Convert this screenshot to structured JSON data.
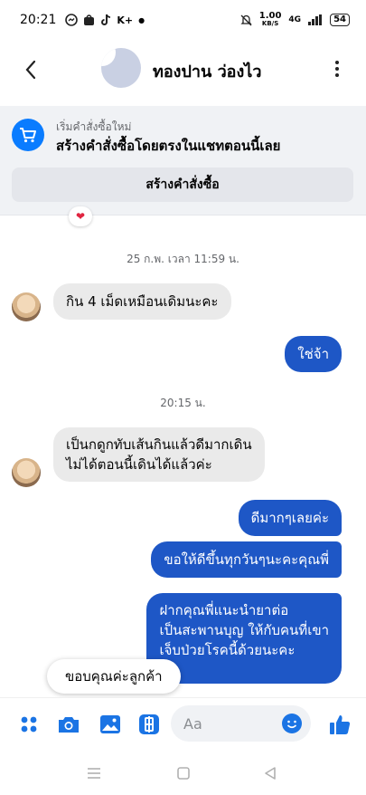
{
  "status_bar": {
    "time": "20:21",
    "left_icons": [
      "messenger-icon",
      "shopee-icon",
      "tiktok-icon"
    ],
    "left_text": "K+",
    "speed": "1.00",
    "speed_unit": "KB/S",
    "network": "4G",
    "battery": "54"
  },
  "header": {
    "back_label": "‹",
    "contact_name": "ทองปาน ว่องไว"
  },
  "order_banner": {
    "small_text": "เริ่มคำสั่งซื้อใหม่",
    "title": "สร้างคำสั่งซื้อโดยตรงในแชทตอนนี้เลย",
    "button_label": "สร้างคำสั่งซื้อ"
  },
  "chat": {
    "reaction": "❤",
    "timestamp_1": "25 ก.พ. เวลา 11:59 น.",
    "msg_in_1": "กิน 4 เม็ดเหมือนเดิมนะคะ",
    "msg_out_1": "ใช่จ้า",
    "timestamp_2": "20:15 น.",
    "msg_in_2_line1": "เป็นกดูกทับเส้นกินแล้วดีมากเดิน",
    "msg_in_2_line2": "ไม่ได้ตอนนี้เดินได้แล้วค่ะ",
    "msg_out_2": "ดีมากๆเลยค่ะ",
    "msg_out_3": "ขอให้ดีขึ้นทุกวันๆนะคะคุณพี่",
    "msg_out_4_line1": "ฝากคุณพี่แนะนำยาต่อ",
    "msg_out_4_line2": "เป็นสะพานบุญ ให้กับคนที่เขา",
    "msg_out_4_line3": "เจ็บป่วยโรคนี้ด้วยนะคะ"
  },
  "quick_reply": {
    "label": "ขอบคุณค่ะลูกค้า"
  },
  "composer": {
    "placeholder": "Aa",
    "icons": [
      "apps-icon",
      "camera-icon",
      "gallery-icon",
      "sticker-icon",
      "emoji-icon",
      "like-icon"
    ]
  },
  "colors": {
    "accent": "#1b74e4",
    "bubble_out": "#1e57c6",
    "bubble_in": "#eaeaea",
    "banner_bg": "#f0f2f5"
  }
}
